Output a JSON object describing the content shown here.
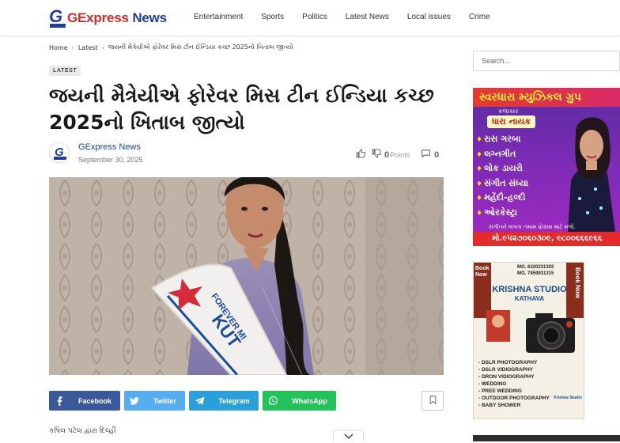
{
  "site": {
    "logo_g": "G",
    "logo_express": "Express",
    "logo_news": "News",
    "colors": {
      "brand_blue": "#1f3f9b",
      "brand_red": "#d12a2a",
      "link_blue": "#1f3f9b"
    }
  },
  "nav": {
    "items": [
      "Entertainment",
      "Sports",
      "Politics",
      "Latest News",
      "Local issues",
      "Crime"
    ]
  },
  "breadcrumb": {
    "home": "Home",
    "latest": "Latest",
    "current": "જયની મૈત્રેયીએ ફોરેવર મિસ ટીન ઈન્ડિયા કચ્છ 2025નો ખિતાબ જીત્યો"
  },
  "article": {
    "badge": "LATEST",
    "title": "જયની મૈત્રેયીએ ફોરેવર મિસ ટીન ઈન્ડિયા કચ્છ 2025નો ખિતાબ જીત્યો",
    "author": "GExpress News",
    "date": "September 30, 2025",
    "points_value": "0",
    "points_label": "Points",
    "comments": "0",
    "hero_sash_text": "FOREVER MI",
    "hero_sash_text2": "KUT",
    "byline": "કપિલ પટેલ દ્વારા દિલ્હી"
  },
  "share": {
    "facebook": "Facebook",
    "twitter": "Twitter",
    "telegram": "Telegram",
    "whatsapp": "WhatsApp"
  },
  "sidebar": {
    "search_placeholder": "Search...",
    "ad1": {
      "headline": "સ્વરધારા મ્યુઝિકલ ગ્રુપ",
      "sub": "કલાકાર",
      "name": "ધારા નાયક",
      "items": [
        "રાસ ગરબા",
        "લગ્નગીત",
        "લોક ડાયરો",
        "સંગીત સંધ્યા",
        "મહેંદી-હલ્દી",
        "ઓરકેસ્ટ્રા"
      ],
      "footer": "સંગીતને લગતા તમામ પ્રોગ્રામ માટે મળો.",
      "phone": "મો.૯૫૨૭૦૬૦૩૦૯, ૯૮૦૦૬૬૬૯૬૬"
    },
    "ad2": {
      "book_now_left": "Book Now",
      "book_now_right": "Book Now",
      "mo1": "MO. 6320231302",
      "mo2": "MO. 7859931315",
      "studio": "KRISHNA STUDIO",
      "place": "KATHAVA",
      "services": [
        "DSLR PHOTOGRAPHY",
        "DSLR VIDIOGRAPHY",
        "DRON VIDIOGRAPHY",
        "WEDDING",
        "PREE WEDDING",
        "OUTDOOR PHOTOGRAPHY",
        "BABY SHOWER"
      ],
      "logo_text": "Krishna Studio"
    }
  }
}
